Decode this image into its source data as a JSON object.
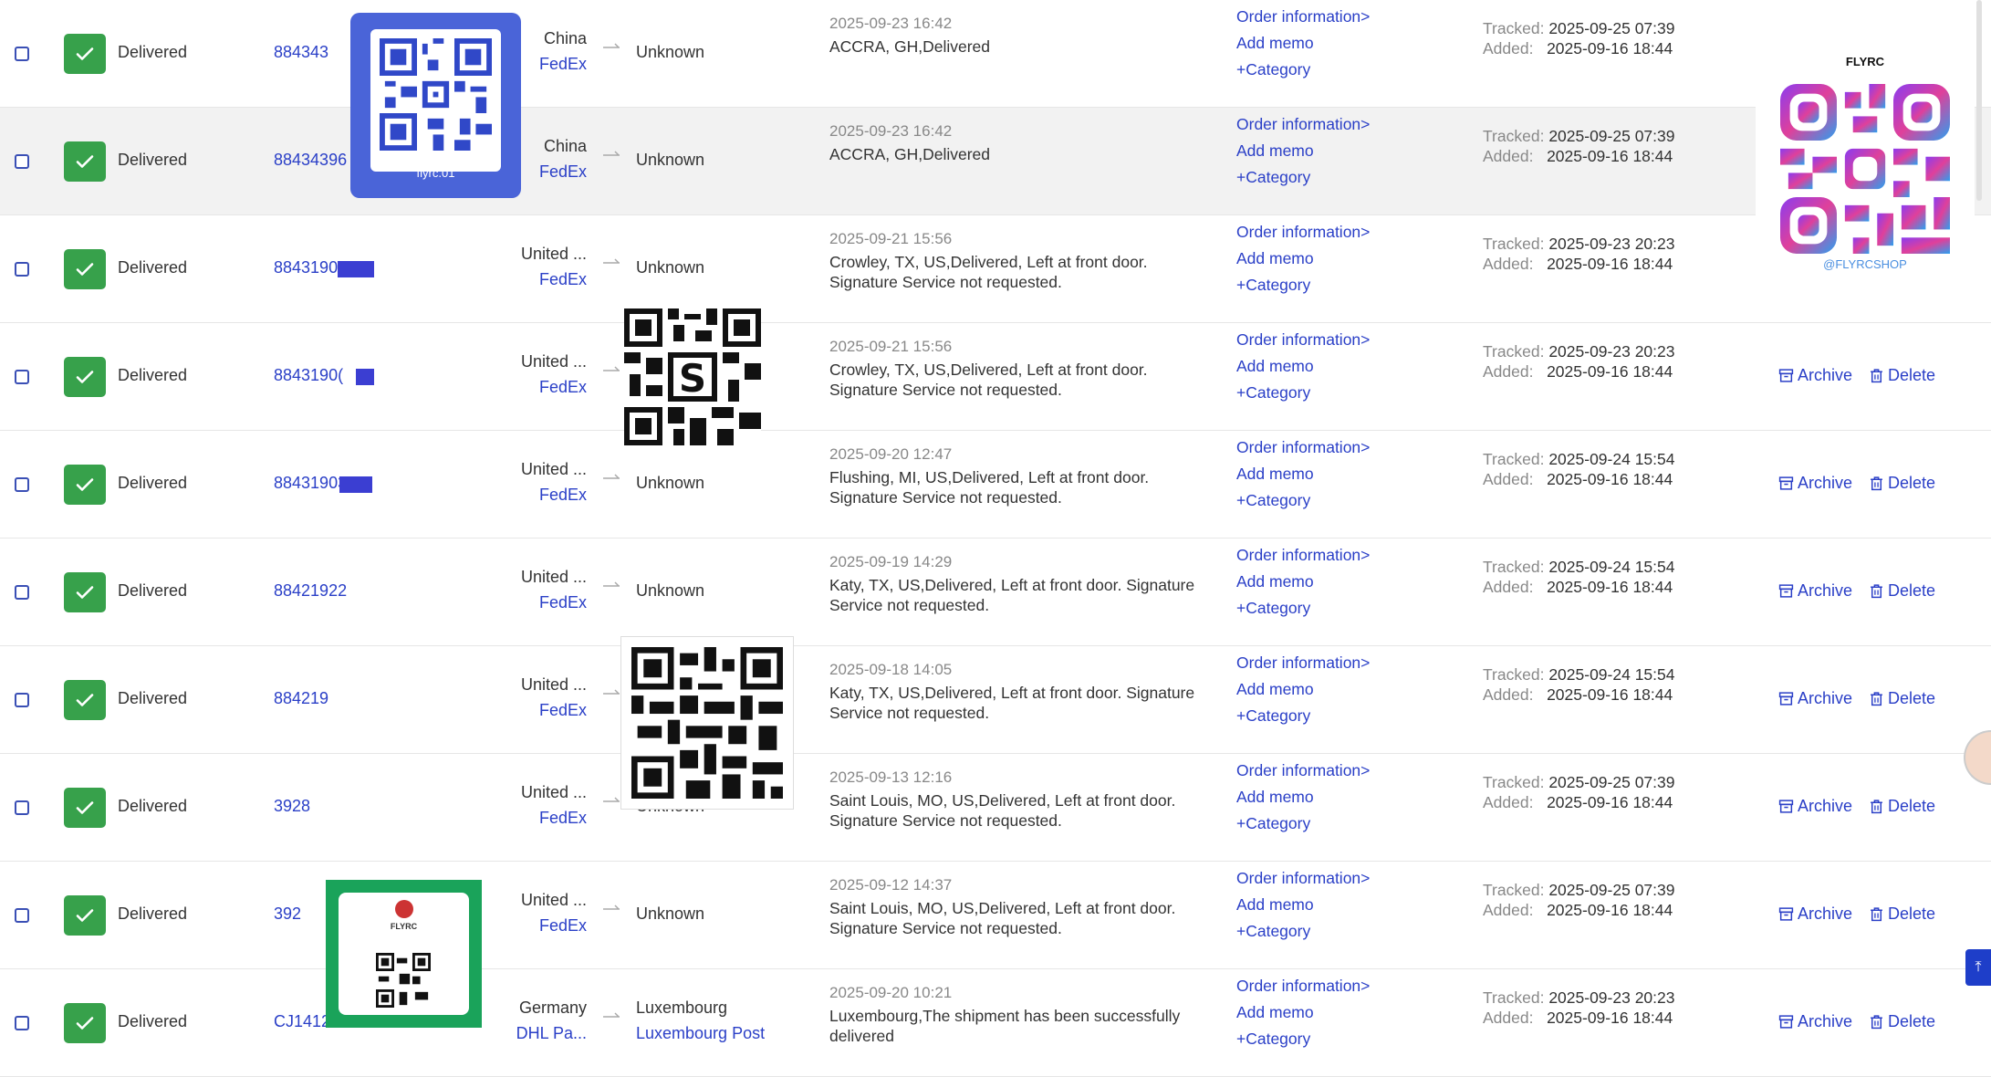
{
  "rows": [
    {
      "status": "Delivered",
      "tracking": "884343",
      "origin": "China",
      "origin_carrier": "FedEx",
      "dest": "Unknown",
      "dest_carrier": "",
      "event_time": "2025-09-23 16:42",
      "event_desc": "ACCRA, GH,Delivered",
      "tracked": "2025-09-25 07:39",
      "added": "2025-09-16 18:44",
      "highlight": false
    },
    {
      "status": "Delivered",
      "tracking": "88434396",
      "origin": "China",
      "origin_carrier": "FedEx",
      "dest": "Unknown",
      "dest_carrier": "",
      "event_time": "2025-09-23 16:42",
      "event_desc": "ACCRA, GH,Delivered",
      "tracked": "2025-09-25 07:39",
      "added": "2025-09-16 18:44",
      "highlight": true
    },
    {
      "status": "Delivered",
      "tracking": "88431909",
      "origin": "United ...",
      "origin_carrier": "FedEx",
      "dest": "Unknown",
      "dest_carrier": "",
      "event_time": "2025-09-21 15:56",
      "event_desc": "Crowley, TX, US,Delivered, Left at front door. Signature Service not requested.",
      "tracked": "2025-09-23 20:23",
      "added": "2025-09-16 18:44",
      "highlight": false
    },
    {
      "status": "Delivered",
      "tracking": "8843190(",
      "origin": "United ...",
      "origin_carrier": "FedEx",
      "dest": "Unknown",
      "dest_carrier": "",
      "event_time": "2025-09-21 15:56",
      "event_desc": "Crowley, TX, US,Delivered, Left at front door. Signature Service not requested.",
      "tracked": "2025-09-23 20:23",
      "added": "2025-09-16 18:44",
      "highlight": false
    },
    {
      "status": "Delivered",
      "tracking": "88431903",
      "origin": "United ...",
      "origin_carrier": "FedEx",
      "dest": "Unknown",
      "dest_carrier": "",
      "event_time": "2025-09-20 12:47",
      "event_desc": "Flushing, MI, US,Delivered, Left at front door. Signature Service not requested.",
      "tracked": "2025-09-24 15:54",
      "added": "2025-09-16 18:44",
      "highlight": false
    },
    {
      "status": "Delivered",
      "tracking": "88421922",
      "origin": "United ...",
      "origin_carrier": "FedEx",
      "dest": "Unknown",
      "dest_carrier": "",
      "event_time": "2025-09-19 14:29",
      "event_desc": "Katy, TX, US,Delivered, Left at front door. Signature Service not requested.",
      "tracked": "2025-09-24 15:54",
      "added": "2025-09-16 18:44",
      "highlight": false
    },
    {
      "status": "Delivered",
      "tracking": "884219",
      "origin": "United ...",
      "origin_carrier": "FedEx",
      "dest": "Unknown",
      "dest_carrier": "",
      "event_time": "2025-09-18 14:05",
      "event_desc": "Katy, TX, US,Delivered, Left at front door. Signature Service not requested.",
      "tracked": "2025-09-24 15:54",
      "added": "2025-09-16 18:44",
      "highlight": false
    },
    {
      "status": "Delivered",
      "tracking": "3928",
      "origin": "United ...",
      "origin_carrier": "FedEx",
      "dest": "Unknown",
      "dest_carrier": "",
      "event_time": "2025-09-13 12:16",
      "event_desc": "Saint Louis, MO, US,Delivered, Left at front door. Signature Service not requested.",
      "tracked": "2025-09-25 07:39",
      "added": "2025-09-16 18:44",
      "highlight": false
    },
    {
      "status": "Delivered",
      "tracking": "392",
      "origin": "United ...",
      "origin_carrier": "FedEx",
      "dest": "Unknown",
      "dest_carrier": "",
      "event_time": "2025-09-12 14:37",
      "event_desc": "Saint Louis, MO, US,Delivered, Left at front door. Signature Service not requested.",
      "tracked": "2025-09-25 07:39",
      "added": "2025-09-16 18:44",
      "highlight": false
    },
    {
      "status": "Delivered",
      "tracking": "CJ1412",
      "origin": "Germany",
      "origin_carrier": "DHL Pa...",
      "dest": "Luxembourg",
      "dest_carrier": "Luxembourg Post",
      "event_time": "2025-09-20 10:21",
      "event_desc": "Luxembourg,The shipment has been successfully delivered",
      "tracked": "2025-09-23 20:23",
      "added": "2025-09-16 18:44",
      "highlight": false
    }
  ],
  "labels": {
    "order_info": "Order information>",
    "add_memo": "Add memo",
    "category": "+Category",
    "tracked": "Tracked:",
    "added": "Added:",
    "archive": "Archive",
    "delete": "Delete"
  },
  "overlays": {
    "qr1_caption": "flyrc.01",
    "brand": "FLYRC",
    "shop_handle": "@FLYRCSHOP",
    "card_brand": "FLYRC"
  },
  "side": {
    "top_button": "⤒"
  },
  "colors": {
    "accent": "#2a3fc7",
    "delivered": "#37a14b",
    "qr_blue": "#4a64d8",
    "qr_green": "#1aa35a"
  }
}
